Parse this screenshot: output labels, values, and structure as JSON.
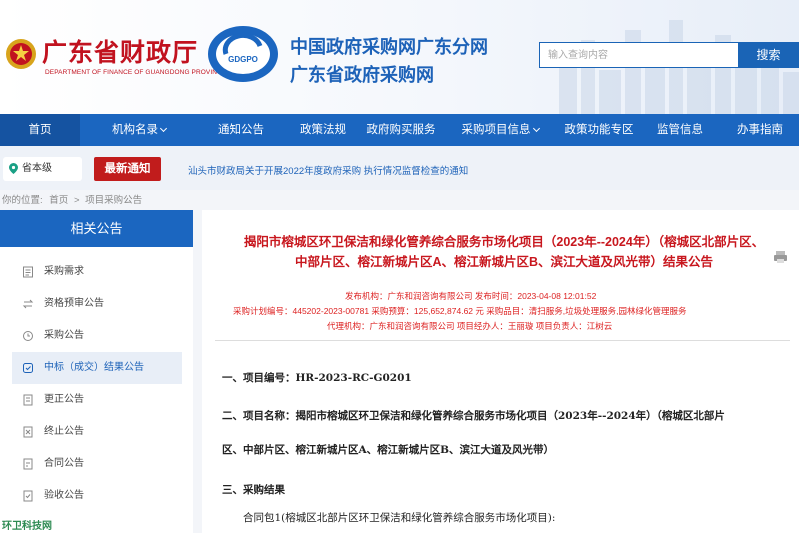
{
  "header": {
    "dept_name_cn": "广东省财政厅",
    "dept_name_en": "DEPARTMENT OF FINANCE OF GUANGDONG PROVINCE",
    "logo_text": "GDGPO",
    "portal_line1": "中国政府采购网广东分网",
    "portal_line2": "广东省政府采购网",
    "search_placeholder": "输入查询内容",
    "search_button": "搜索"
  },
  "nav": {
    "items": [
      "首页",
      "机构名录",
      "通知公告",
      "政策法规",
      "政府购买服务",
      "采购项目信息",
      "政策功能专区",
      "监管信息",
      "办事指南"
    ]
  },
  "notice": {
    "region": "省本级",
    "badge": "最新通知",
    "ticker": "汕头市财政局关于开展2022年度政府采购 执行情况监督检查的通知"
  },
  "breadcrumb": {
    "prefix": "你的位置:",
    "home": "首页",
    "sep": ">",
    "current": "项目采购公告"
  },
  "sidebar": {
    "heading": "相关公告",
    "items": [
      "采购需求",
      "资格预审公告",
      "采购公告",
      "中标（成交）结果公告",
      "更正公告",
      "终止公告",
      "合同公告",
      "验收公告"
    ],
    "active_index": 3,
    "watermark": "环卫科技网"
  },
  "article": {
    "title_line1": "揭阳市榕城区环卫保洁和绿化管养综合服务市场化项目（2023年--2024年）（榕城区北部片区、",
    "title_line2": "中部片区、榕江新城片区A、榕江新城片区B、滨江大道及风光带）结果公告",
    "meta_row1": "发布机构：广东和润咨询有限公司        发布时间：2023-04-08 12:01:52",
    "meta_row2": "采购计划编号：445202-2023-00781    采购预算：125,652,874.62 元    采购品目：清扫服务,垃圾处理服务,园林绿化管理服务",
    "meta_row3": "代理机构：广东和润咨询有限公司    项目经办人：王丽璇    项目负责人：江树云",
    "line1": "一、项目编号：HR-2023-RC-G0201",
    "line2": "二、项目名称：揭阳市榕城区环卫保洁和绿化管养综合服务市场化项目（2023年--2024年）（榕城区北部片",
    "line3": "区、中部片区、榕江新城片区A、榕江新城片区B、滨江大道及风光带）",
    "line4": "三、采购结果",
    "line5": "合同包1(榕城区北部片区环卫保洁和绿化管养综合服务市场化项目):"
  },
  "colors": {
    "brand_blue": "#1b66c0",
    "dept_red": "#c1121f",
    "badge_red": "#c11c1c",
    "title_red": "#c8171e"
  }
}
